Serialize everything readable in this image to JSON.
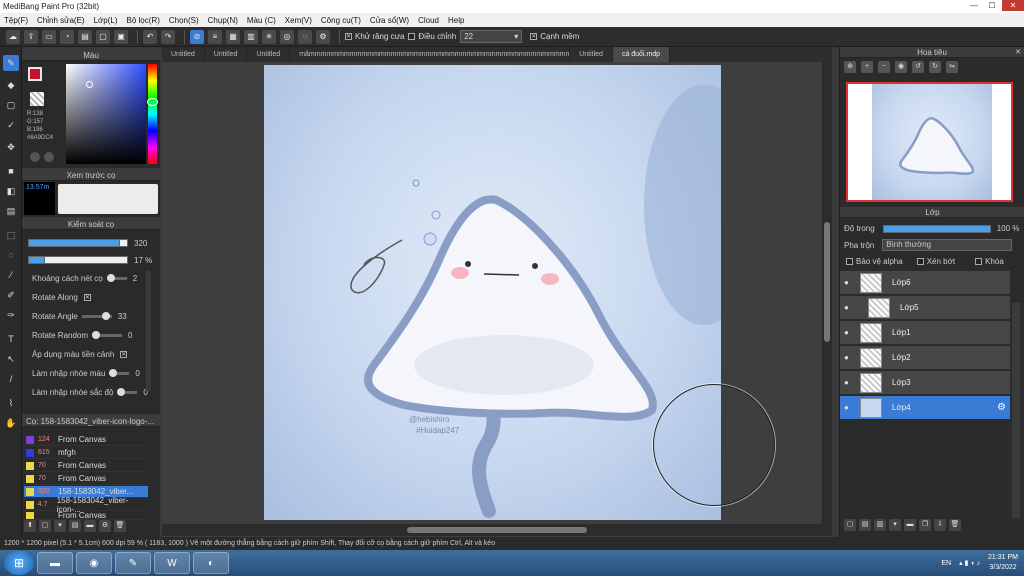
{
  "window": {
    "title": "MediBang Paint Pro (32bit)"
  },
  "menu": [
    "Tệp(F)",
    "Chỉnh sửa(E)",
    "Lớp(L)",
    "Bộ lọc(R)",
    "Chọn(S)",
    "Chụp(N)",
    "Màu (C)",
    "Xem(V)",
    "Công cụ(T)",
    "Cửa sổ(W)",
    "Cloud",
    "Help"
  ],
  "toolbar": {
    "antialias_label": "Khử răng cưa",
    "correction_label": "Điều chỉnh",
    "correction_value": "22",
    "edge_label": "Cạnh mềm"
  },
  "color_panel": {
    "title": "Màu",
    "r": "R:138",
    "g": "G:157",
    "b": "B:196",
    "hex": "#8A9DC4"
  },
  "preview_panel": {
    "title": "Xem trước cọ",
    "size": "13.57m"
  },
  "control_panel": {
    "title": "Kiểm soát cọ",
    "size_value": "320",
    "size_fill": 0.92,
    "opacity_value": "17 %",
    "opacity_fill": 0.17,
    "rows": [
      {
        "label": "Khoảng cách nét cọ",
        "value": "2"
      },
      {
        "label": "Rotate Along",
        "value": ""
      },
      {
        "label": "Rotate Angle",
        "value": "33"
      },
      {
        "label": "Rotate Random",
        "value": "0"
      },
      {
        "label": "Áp dụng màu tiền cảnh",
        "value": ""
      },
      {
        "label": "Làm nhập nhòe màu",
        "value": "0"
      },
      {
        "label": "Làm nhập nhòe sắc độ",
        "value": "0"
      }
    ]
  },
  "brush_list": {
    "title": "Cọ: 158-1583042_viber-icon-logo-...",
    "items": [
      {
        "num": "124",
        "name": "From Canvas",
        "color": "#7e3fd8"
      },
      {
        "num": "615",
        "name": "mfgh",
        "color": "#2a3fd8"
      },
      {
        "num": "70",
        "name": "From Canvas",
        "color": "#e8d84a"
      },
      {
        "num": "70",
        "name": "From Canvas",
        "color": "#e8d84a"
      },
      {
        "num": "320",
        "name": "158-1583042_viber...",
        "color": "#e8d84a"
      },
      {
        "num": "4.7",
        "name": "158-1583042_viber-icon-...",
        "color": "#e8d84a"
      },
      {
        "num": "",
        "name": "From Canvas",
        "color": "#e8d84a"
      }
    ]
  },
  "tabs": [
    "Untitled",
    "Untitled",
    "Untitled",
    "mămmmmmmmmmmmmmmmmmmmmmmmmmmmmmmmmmmmmmmmmmmmmmmmmmmm.mdp",
    "Untitled",
    "cá đuối.mdp"
  ],
  "canvas": {
    "watermark1": "@hebishiro",
    "watermark2": "#Huidap247"
  },
  "navigator": {
    "title": "Hoa tiêu"
  },
  "layer_panel": {
    "title": "Lớp",
    "opacity_label": "Độ trong",
    "opacity_value": "100 %",
    "blend_label": "Pha trộn",
    "blend_value": "Bình thường",
    "protect_alpha": "Bảo vệ alpha",
    "clipping": "Xén bớt",
    "lock": "Khóa",
    "layers": [
      "Lớp6",
      "Lớp5",
      "Lớp1",
      "Lớp2",
      "Lớp3",
      "Lớp4"
    ]
  },
  "status": {
    "text": "1200 * 1200 pixel   (5.1 * 5.1cm)  600 dpi  59 %  ( 1183, 1000 )  Vẽ một đường thẳng bằng cách giữ phím Shift, Thay đổi cỡ cọ bằng cách giữ phím Ctrl, Alt và kéo"
  },
  "taskbar": {
    "lang": "EN",
    "time": "21:31 PM",
    "date": "3/3/2022"
  }
}
